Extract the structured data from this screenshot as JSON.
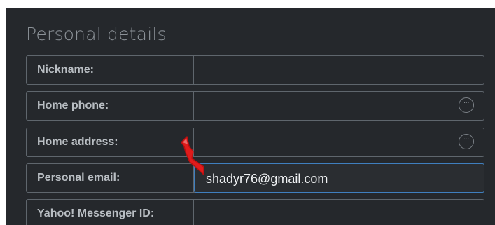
{
  "section": {
    "title": "Personal details"
  },
  "fields": [
    {
      "label": "Nickname:",
      "value": ""
    },
    {
      "label": "Home phone:",
      "value": "",
      "more_icon": "ellipsis-circle-icon"
    },
    {
      "label": "Home address:",
      "value": "",
      "more_icon": "ellipsis-circle-icon"
    },
    {
      "label": "Personal email:",
      "value": "shadyr76@gmail.com",
      "focused": true
    },
    {
      "label": "Yahoo! Messenger ID:",
      "value": ""
    }
  ],
  "annotation": {
    "icon": "red-arrow-annotation",
    "color": "#e01b1b"
  },
  "colors": {
    "panel_background": "#25282c",
    "border": "#5f666d",
    "focus_border": "#3f7fbf"
  }
}
